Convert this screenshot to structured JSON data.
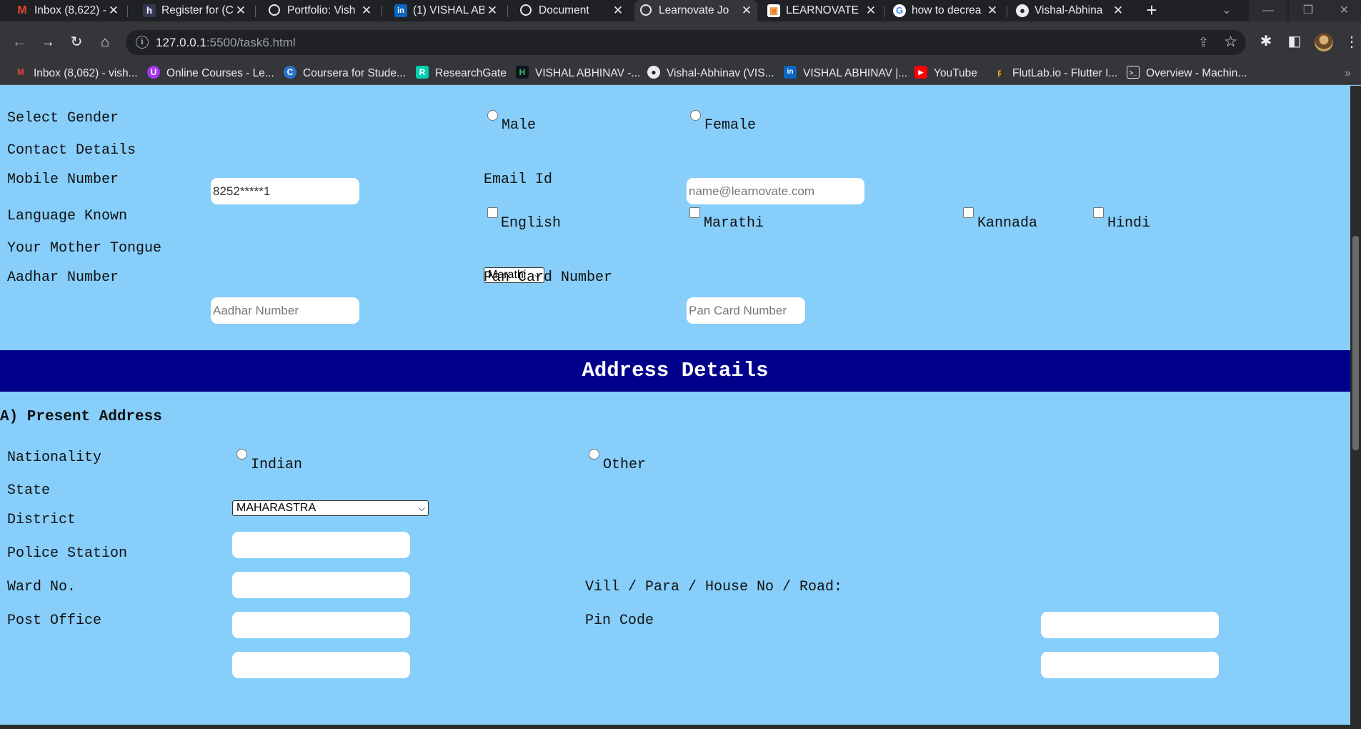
{
  "tabs": [
    {
      "title": "Inbox (8,622) -",
      "icon": "gmail-icon"
    },
    {
      "title": "Register for (C",
      "icon": "hackerearth-icon"
    },
    {
      "title": "Portfolio: Vish",
      "icon": "globe-icon"
    },
    {
      "title": "(1) VISHAL AB",
      "icon": "linkedin-icon"
    },
    {
      "title": "Document",
      "icon": "globe-icon"
    },
    {
      "title": "Learnovate Jo",
      "icon": "globe-icon"
    },
    {
      "title": "LEARNOVATE",
      "icon": "learnovate-icon"
    },
    {
      "title": "how to decrea",
      "icon": "google-icon"
    },
    {
      "title": "Vishal-Abhina",
      "icon": "github-icon"
    }
  ],
  "address_bar": {
    "host": "127.0.0.1",
    "path": ":5500/task6.html"
  },
  "bookmarks": [
    {
      "label": "Inbox (8,062) - vish...",
      "icon": "gmail-icon"
    },
    {
      "label": "Online Courses - Le...",
      "icon": "udemy-icon"
    },
    {
      "label": "Coursera for Stude...",
      "icon": "coursera-icon"
    },
    {
      "label": "ResearchGate",
      "icon": "researchgate-icon"
    },
    {
      "label": "VISHAL ABHINAV -...",
      "icon": "hackerrank-icon"
    },
    {
      "label": "Vishal-Abhinav (VIS...",
      "icon": "github-icon"
    },
    {
      "label": "VISHAL ABHINAV |...",
      "icon": "linkedin-icon"
    },
    {
      "label": "YouTube",
      "icon": "youtube-icon"
    },
    {
      "label": "FlutLab.io - Flutter I...",
      "icon": "flutlab-icon"
    },
    {
      "label": "Overview - Machin...",
      "icon": "console-icon"
    }
  ],
  "form": {
    "gender": {
      "label": "Select Gender",
      "options": [
        "Male",
        "Female"
      ]
    },
    "contact_heading": "Contact Details",
    "mobile": {
      "label": "Mobile Number",
      "value": "8252*****1"
    },
    "email": {
      "label": "Email Id",
      "placeholder": "name@learnovate.com"
    },
    "languages": {
      "label": "Language Known",
      "options": [
        "English",
        "Marathi",
        "Kannada",
        "Hindi"
      ]
    },
    "mother_tongue": {
      "label": "Your Mother Tongue",
      "selected": "Marathi"
    },
    "aadhar": {
      "label": "Aadhar Number",
      "placeholder": "Aadhar Number"
    },
    "pan": {
      "label": "Pan Card Number",
      "placeholder": "Pan Card Number"
    }
  },
  "address": {
    "banner": "Address Details",
    "subheading": "A) Present Address",
    "nationality": {
      "label": "Nationality",
      "options": [
        "Indian",
        "Other"
      ]
    },
    "state": {
      "label": "State",
      "selected": "MAHARASTRA"
    },
    "district_label": "District",
    "police_station_label": "Police Station",
    "ward_label": "Ward No.",
    "village_label": "Vill / Para / House No / Road:",
    "post_office_label": "Post Office",
    "pin_label": "Pin Code"
  },
  "colors": {
    "page_bg": "#87cefa",
    "banner_bg": "#00008b",
    "chrome_bg": "#35363a"
  }
}
